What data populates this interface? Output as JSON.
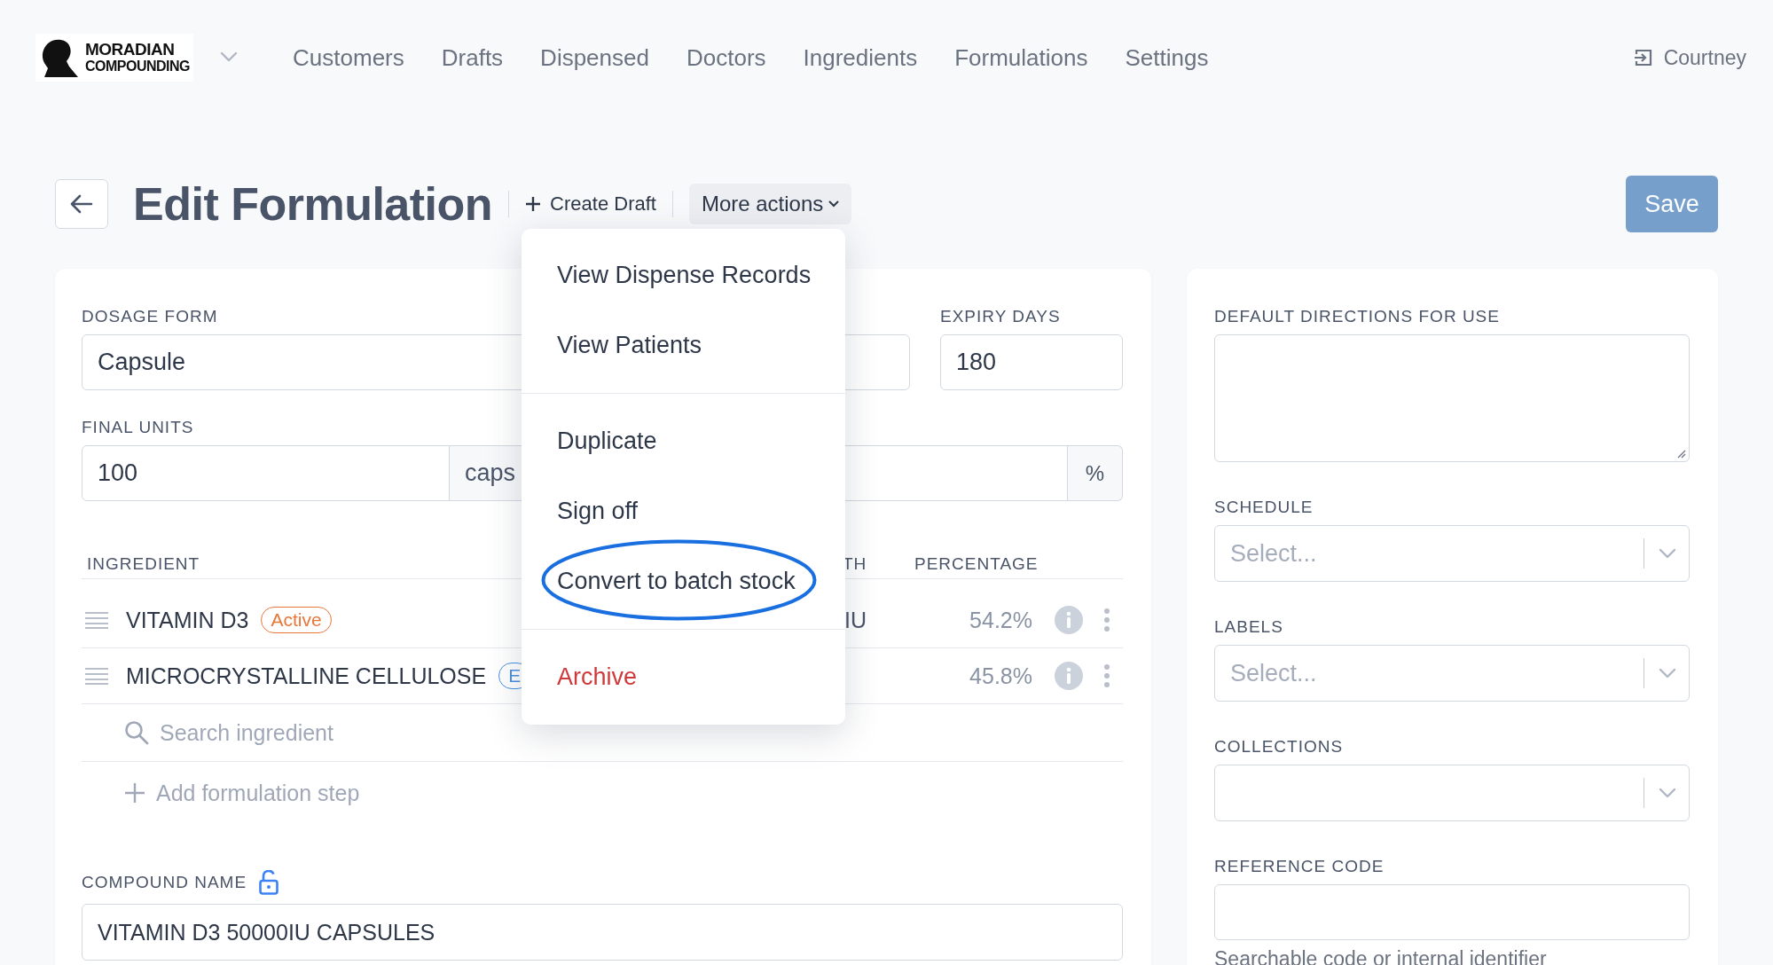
{
  "header": {
    "logo": {
      "lines": [
        "MORADIAN",
        "COMPOUNDING"
      ]
    },
    "nav": [
      {
        "label": "Customers"
      },
      {
        "label": "Drafts"
      },
      {
        "label": "Dispensed"
      },
      {
        "label": "Doctors"
      },
      {
        "label": "Ingredients"
      },
      {
        "label": "Formulations"
      },
      {
        "label": "Settings"
      }
    ],
    "user": "Courtney"
  },
  "toolbar": {
    "title": "Edit Formulation",
    "create_draft": "Create Draft",
    "more_actions": "More actions",
    "save": "Save"
  },
  "menu": {
    "groups": [
      [
        {
          "label": "View Dispense Records",
          "kind": "normal",
          "circled": false
        },
        {
          "label": "View Patients",
          "kind": "normal",
          "circled": false
        }
      ],
      [
        {
          "label": "Duplicate",
          "kind": "normal",
          "circled": false
        },
        {
          "label": "Sign off",
          "kind": "normal",
          "circled": false
        },
        {
          "label": "Convert to batch stock",
          "kind": "normal",
          "circled": true
        }
      ],
      [
        {
          "label": "Archive",
          "kind": "danger",
          "circled": false
        }
      ]
    ]
  },
  "form": {
    "dosage_form": {
      "label": "DOSAGE FORM",
      "value": "Capsule"
    },
    "expiry_days": {
      "label": "EXPIRY DAYS",
      "value": "180"
    },
    "final_units": {
      "label": "FINAL UNITS",
      "value": "100",
      "unit": "caps"
    },
    "field_4": {
      "suffix": "%"
    },
    "ingredients": {
      "columns": [
        "INGREDIENT",
        "TH",
        "PERCENTAGE"
      ],
      "rows": [
        {
          "name": "VITAMIN D3",
          "badge": "Active",
          "color": "#e8773a",
          "column_2": "IU",
          "percentage": "54.2%"
        },
        {
          "name": "MICROCRYSTALLINE CELLULOSE",
          "badge": "E",
          "color": "#4a90e2",
          "percentage": "45.8%"
        }
      ],
      "search_placeholder": "Search ingredient",
      "add_step": "Add formulation step"
    },
    "compound_name": {
      "label": "COMPOUND NAME",
      "value": "VITAMIN D3 50000IU CAPSULES"
    }
  },
  "side": {
    "directions": {
      "label": "DEFAULT DIRECTIONS FOR USE"
    },
    "schedule": {
      "label": "SCHEDULE",
      "placeholder": "Select..."
    },
    "labels": {
      "label": "LABELS",
      "placeholder": "Select..."
    },
    "collections": {
      "label": "COLLECTIONS"
    },
    "reference_code": {
      "label": "REFERENCE CODE",
      "help": "Searchable code or internal identifier"
    }
  }
}
